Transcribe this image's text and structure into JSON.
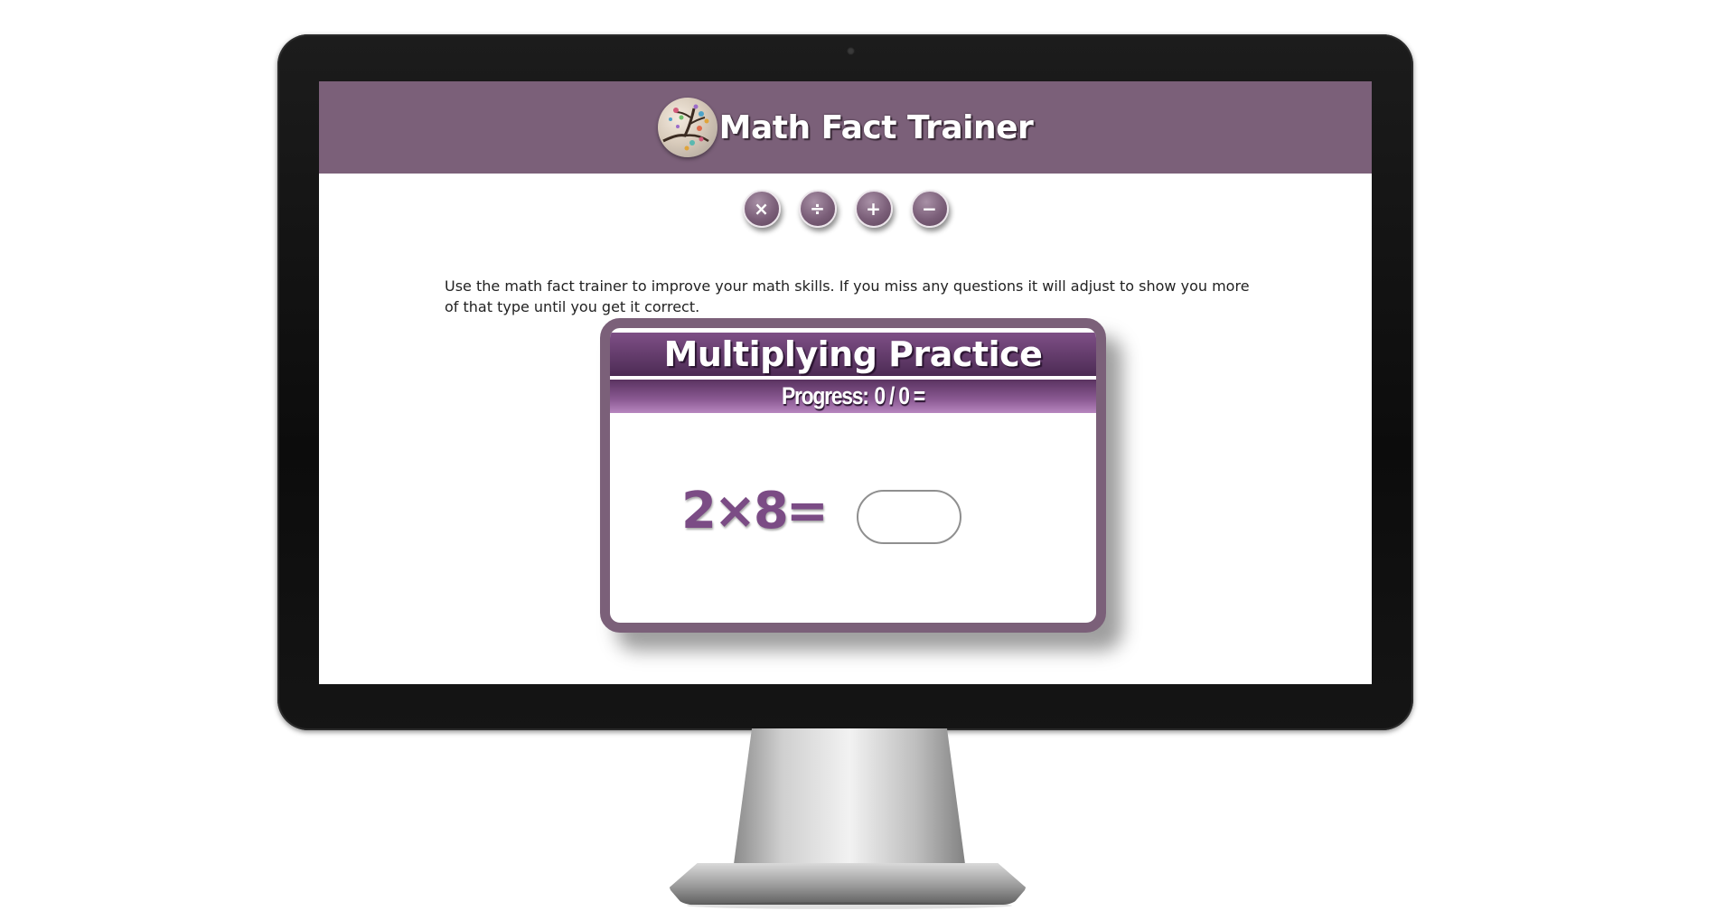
{
  "app": {
    "title": "Math Fact Trainer",
    "logo_icon": "tree-logo-icon"
  },
  "operations": [
    {
      "symbol": "×",
      "name": "multiply"
    },
    {
      "symbol": "÷",
      "name": "divide"
    },
    {
      "symbol": "+",
      "name": "add"
    },
    {
      "symbol": "−",
      "name": "subtract"
    }
  ],
  "intro_text": "Use the math fact trainer to improve your math skills. If you miss any questions it will adjust to show you more of that type until you get it correct.",
  "practice": {
    "title": "Multiplying Practice",
    "progress_label": "Progress:",
    "progress_value": "0 / 0 =",
    "problem": "2×8=",
    "answer_value": ""
  },
  "colors": {
    "header": "#7b6079",
    "accent": "#7b4c85"
  }
}
